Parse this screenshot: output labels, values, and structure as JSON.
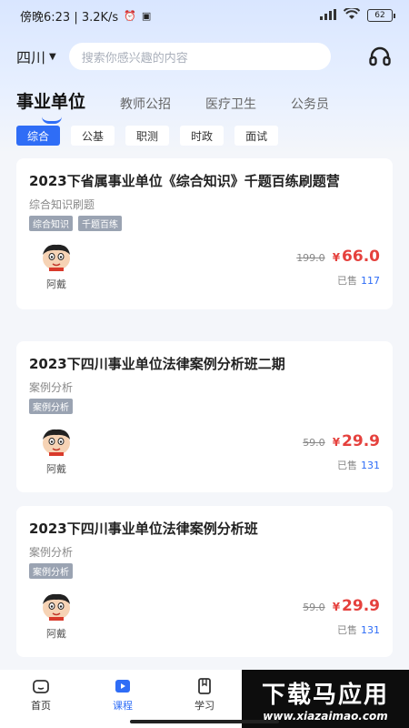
{
  "status_bar": {
    "time": "傍晚6:23 | 3.2K/s",
    "battery": "62"
  },
  "header": {
    "city": "四川",
    "search_placeholder": "搜索你感兴趣的内容"
  },
  "main_tabs": [
    {
      "label": "事业单位",
      "active": true
    },
    {
      "label": "教师公招",
      "active": false
    },
    {
      "label": "医疗卫生",
      "active": false
    },
    {
      "label": "公务员",
      "active": false
    }
  ],
  "sub_tabs": [
    {
      "label": "综合",
      "active": true
    },
    {
      "label": "公基",
      "active": false
    },
    {
      "label": "职测",
      "active": false
    },
    {
      "label": "时政",
      "active": false
    },
    {
      "label": "面试",
      "active": false
    }
  ],
  "courses": [
    {
      "title": "2023下省属事业单位《综合知识》千题百练刷题营",
      "subtitle": "综合知识刷题",
      "tags": [
        "综合知识",
        "千题百练"
      ],
      "teacher": "阿戴",
      "old_price": "199.0",
      "currency": "¥",
      "price": "66.0",
      "sold_label": "已售",
      "sold": "117"
    },
    {
      "title": "2023下四川事业单位法律案例分析班二期",
      "subtitle": "案例分析",
      "tags": [
        "案例分析"
      ],
      "teacher": "阿戴",
      "old_price": "59.0",
      "currency": "¥",
      "price": "29.9",
      "sold_label": "已售",
      "sold": "131"
    },
    {
      "title": "2023下四川事业单位法律案例分析班",
      "subtitle": "案例分析",
      "tags": [
        "案例分析"
      ],
      "teacher": "阿戴",
      "old_price": "59.0",
      "currency": "¥",
      "price": "29.9",
      "sold_label": "已售",
      "sold": "131"
    }
  ],
  "bottom_nav": [
    {
      "label": "首页",
      "icon": "home-icon",
      "active": false
    },
    {
      "label": "课程",
      "icon": "play-icon",
      "active": true
    },
    {
      "label": "学习",
      "icon": "book-icon",
      "active": false
    }
  ],
  "watermark": {
    "main": "下载马应用",
    "url": "www.xiazaimao.com"
  },
  "colors": {
    "accent": "#2f6df6",
    "price": "#e5413d",
    "tag": "#9aa3b2"
  }
}
